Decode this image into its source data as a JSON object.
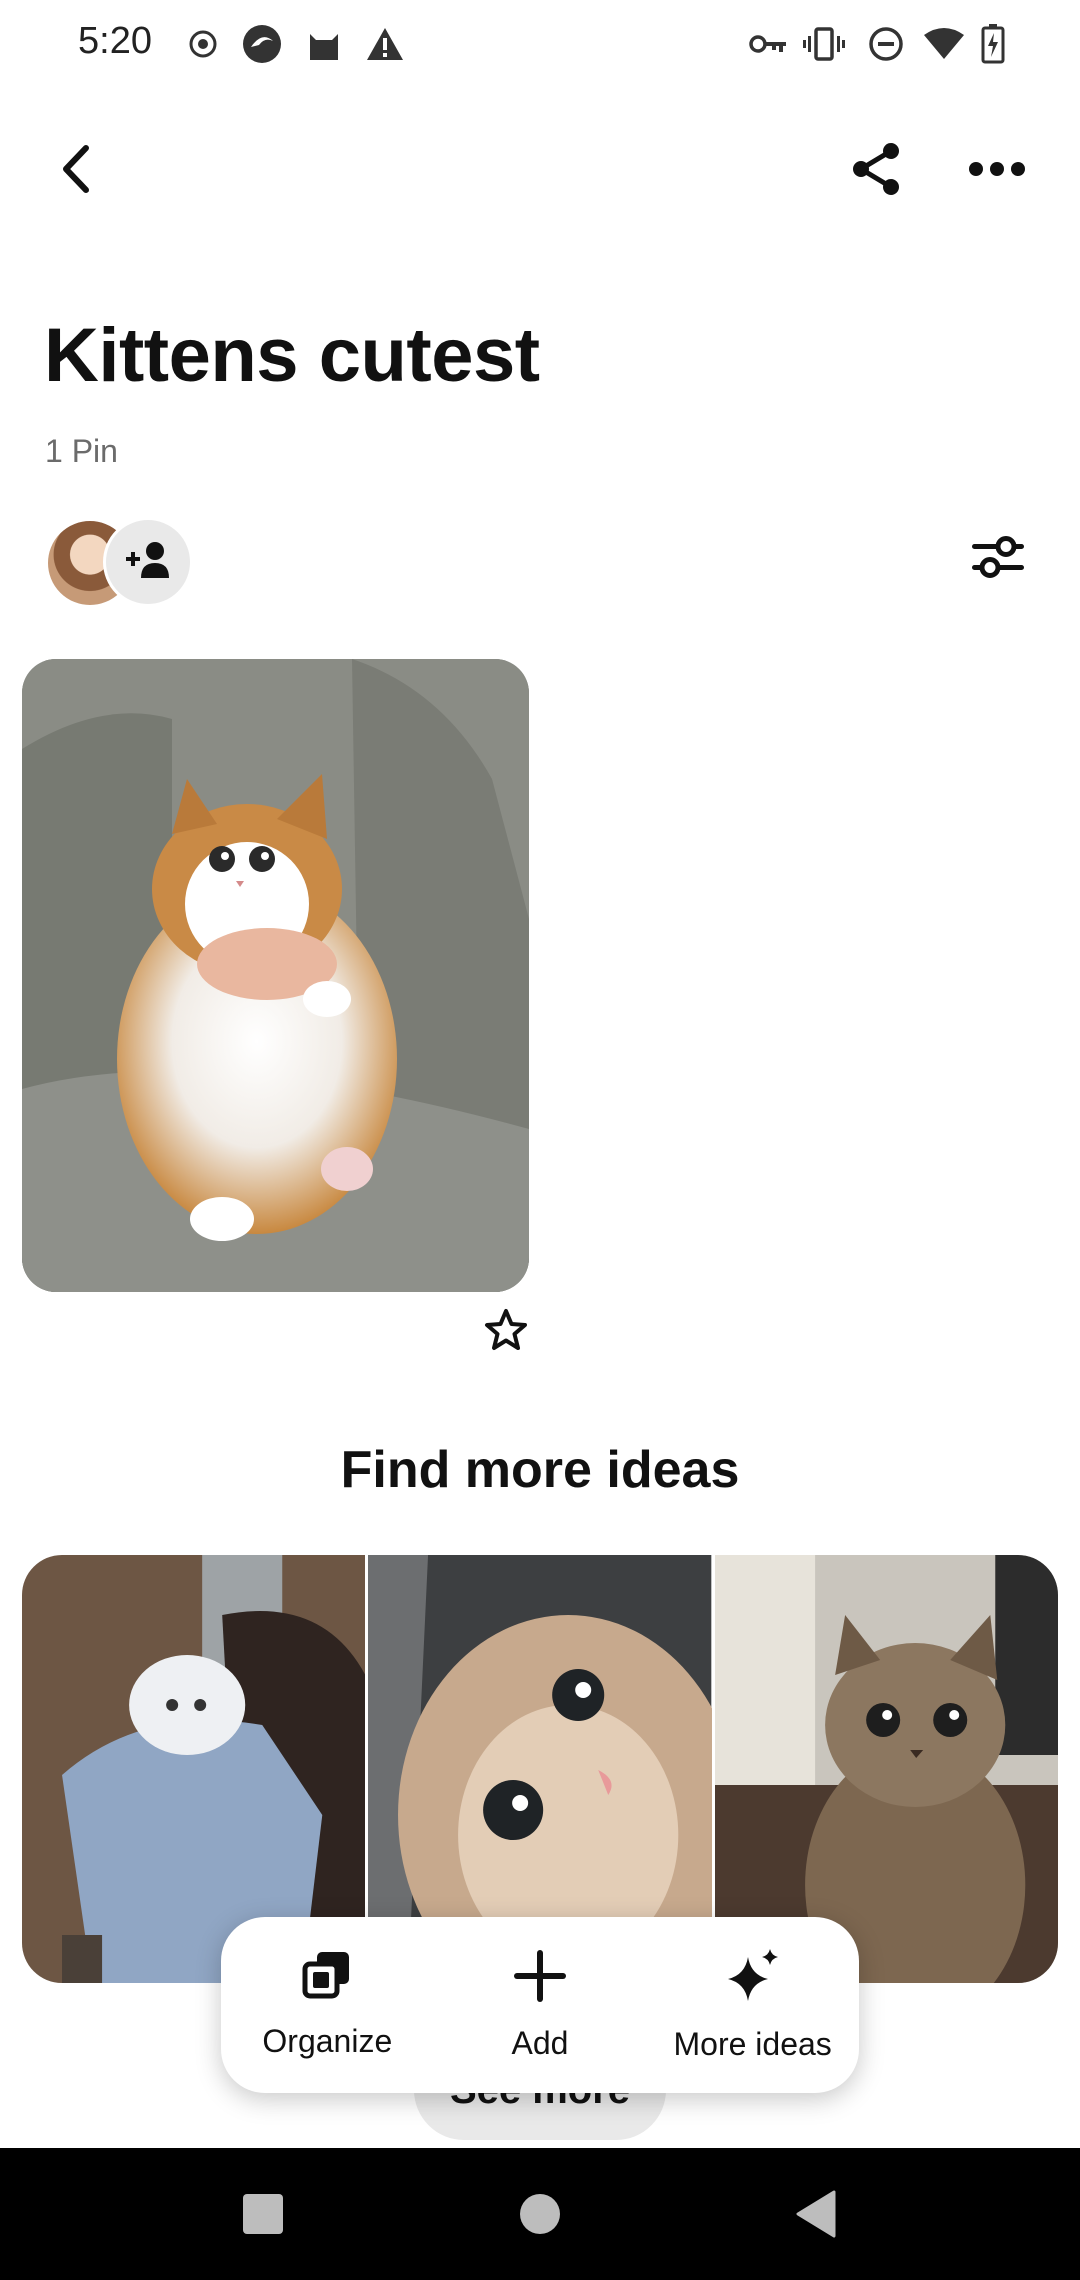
{
  "status_bar": {
    "time": "5:20",
    "left_icons": [
      "record-icon",
      "browser-icon",
      "cat-app-icon",
      "warning-icon"
    ],
    "right_icons": [
      "vpn-key-icon",
      "vibrate-icon",
      "dnd-icon",
      "wifi-icon",
      "battery-charging-icon"
    ]
  },
  "header": {
    "back_icon": "chevron-left-icon",
    "share_icon": "share-icon",
    "more_icon": "more-horizontal-icon"
  },
  "board": {
    "title": "Kittens cutest",
    "pin_count": "1 Pin",
    "collaborator_icon": "add-person-icon",
    "filter_icon": "sliders-icon"
  },
  "pins": [
    {
      "description": "fluffy cat",
      "favorite_icon": "star-outline-icon"
    }
  ],
  "find_more": {
    "heading": "Find more ideas",
    "see_more_label": "See more"
  },
  "toolbar": {
    "organize_label": "Organize",
    "add_label": "Add",
    "more_ideas_label": "More ideas"
  },
  "nav_bar": {
    "recents_icon": "square-icon",
    "home_icon": "circle-icon",
    "back_icon": "triangle-back-icon"
  },
  "colors": {
    "text": "#111111",
    "muted": "#6b6b6b",
    "chip_bg": "#e9e9e9",
    "nav_bg": "#000000"
  }
}
